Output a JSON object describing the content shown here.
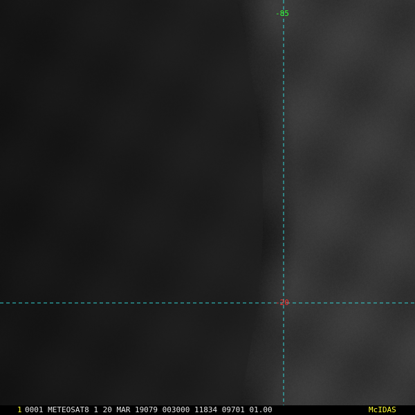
{
  "colors": {
    "gridline": "#33d6d6",
    "lon_label": "#33ff33",
    "lat_label": "#ff3030",
    "frame_number": "#ffff33",
    "brand": "#ffff33",
    "status_text": "#e6e6e6"
  },
  "grid": {
    "longitude_label": "-85",
    "latitude_label": "-20"
  },
  "status_bar": {
    "frame_number": "1",
    "text": "0001 METEOSAT8    1 20 MAR 19079 003000 11834 09701 01.00",
    "brand": "McIDAS"
  }
}
